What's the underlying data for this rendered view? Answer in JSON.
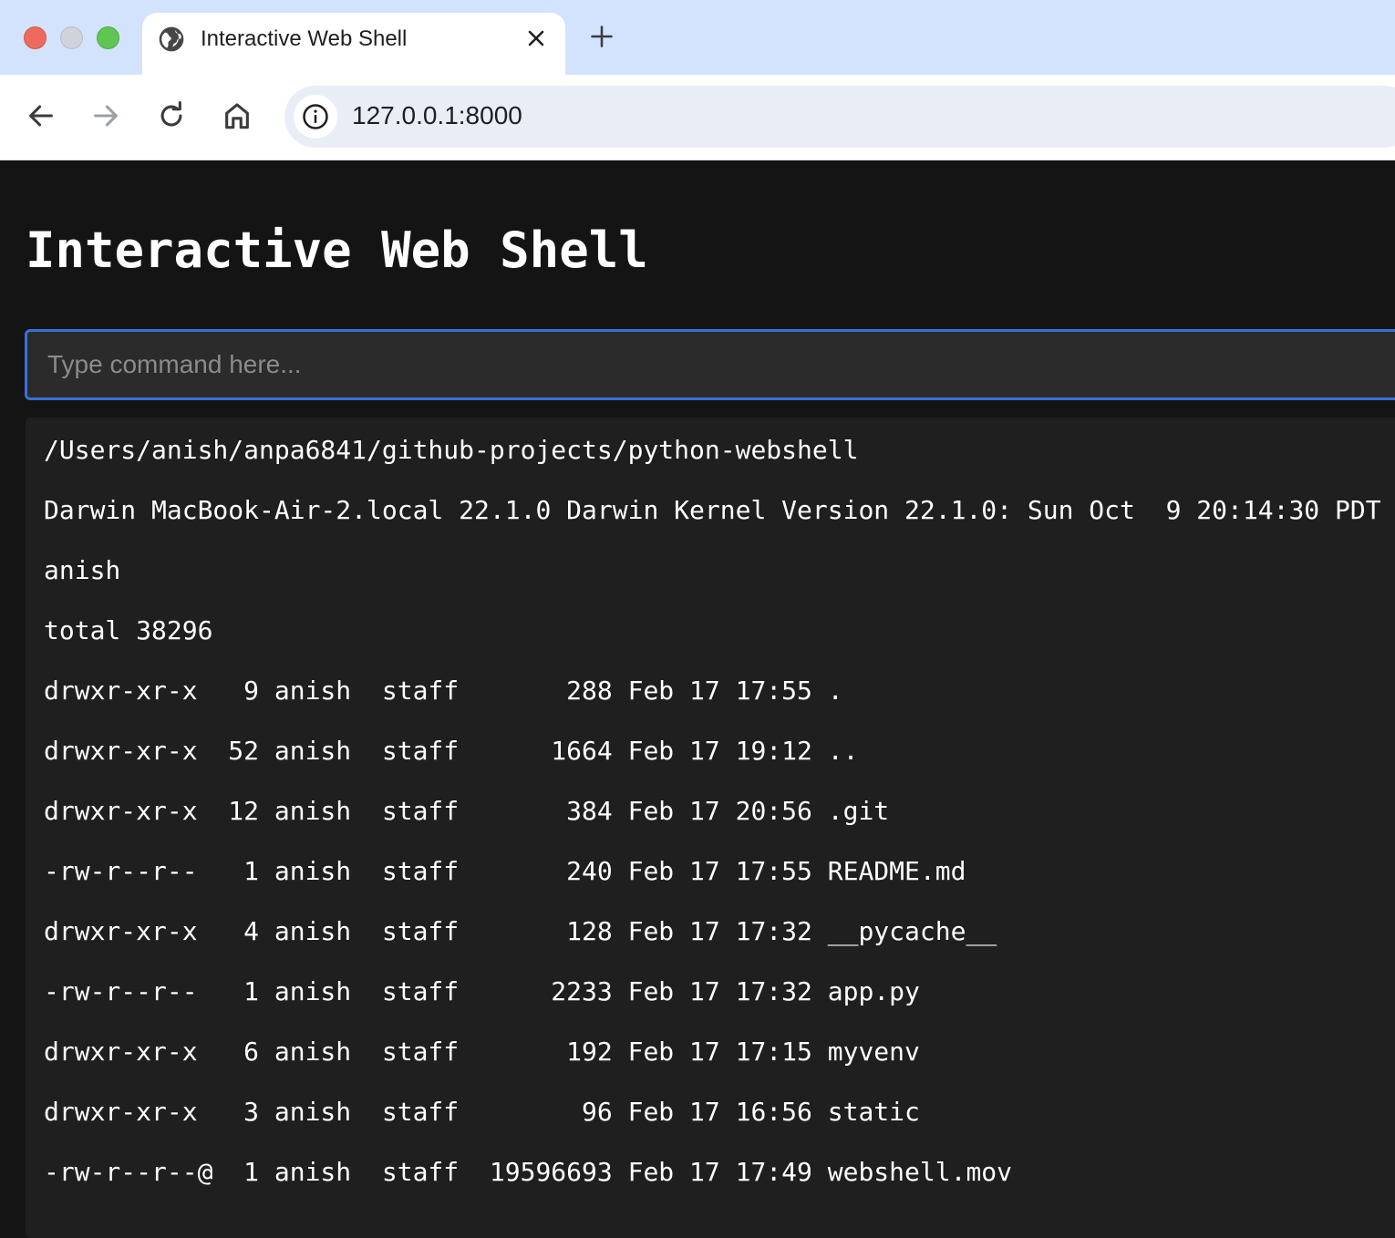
{
  "browser": {
    "tab": {
      "title": "Interactive Web Shell"
    },
    "address_bar": {
      "url": "127.0.0.1:8000"
    }
  },
  "page": {
    "title": "Interactive Web Shell",
    "command_input": {
      "placeholder": "Type command here...",
      "value": ""
    },
    "output_lines": [
      "/Users/anish/anpa6841/github-projects/python-webshell",
      "Darwin MacBook-Air-2.local 22.1.0 Darwin Kernel Version 22.1.0: Sun Oct  9 20:14:30 PDT",
      "anish",
      "total 38296",
      "drwxr-xr-x   9 anish  staff       288 Feb 17 17:55 .",
      "drwxr-xr-x  52 anish  staff      1664 Feb 17 19:12 ..",
      "drwxr-xr-x  12 anish  staff       384 Feb 17 20:56 .git",
      "-rw-r--r--   1 anish  staff       240 Feb 17 17:55 README.md",
      "drwxr-xr-x   4 anish  staff       128 Feb 17 17:32 __pycache__",
      "-rw-r--r--   1 anish  staff      2233 Feb 17 17:32 app.py",
      "drwxr-xr-x   6 anish  staff       192 Feb 17 17:15 myvenv",
      "drwxr-xr-x   3 anish  staff        96 Feb 17 16:56 static",
      "-rw-r--r--@  1 anish  staff  19596693 Feb 17 17:49 webshell.mov"
    ]
  },
  "colors": {
    "tabstrip": "#d3e3fd",
    "page_background": "#141414",
    "output_background": "#1f1f1f",
    "input_focus_border": "#3a6fd8"
  }
}
